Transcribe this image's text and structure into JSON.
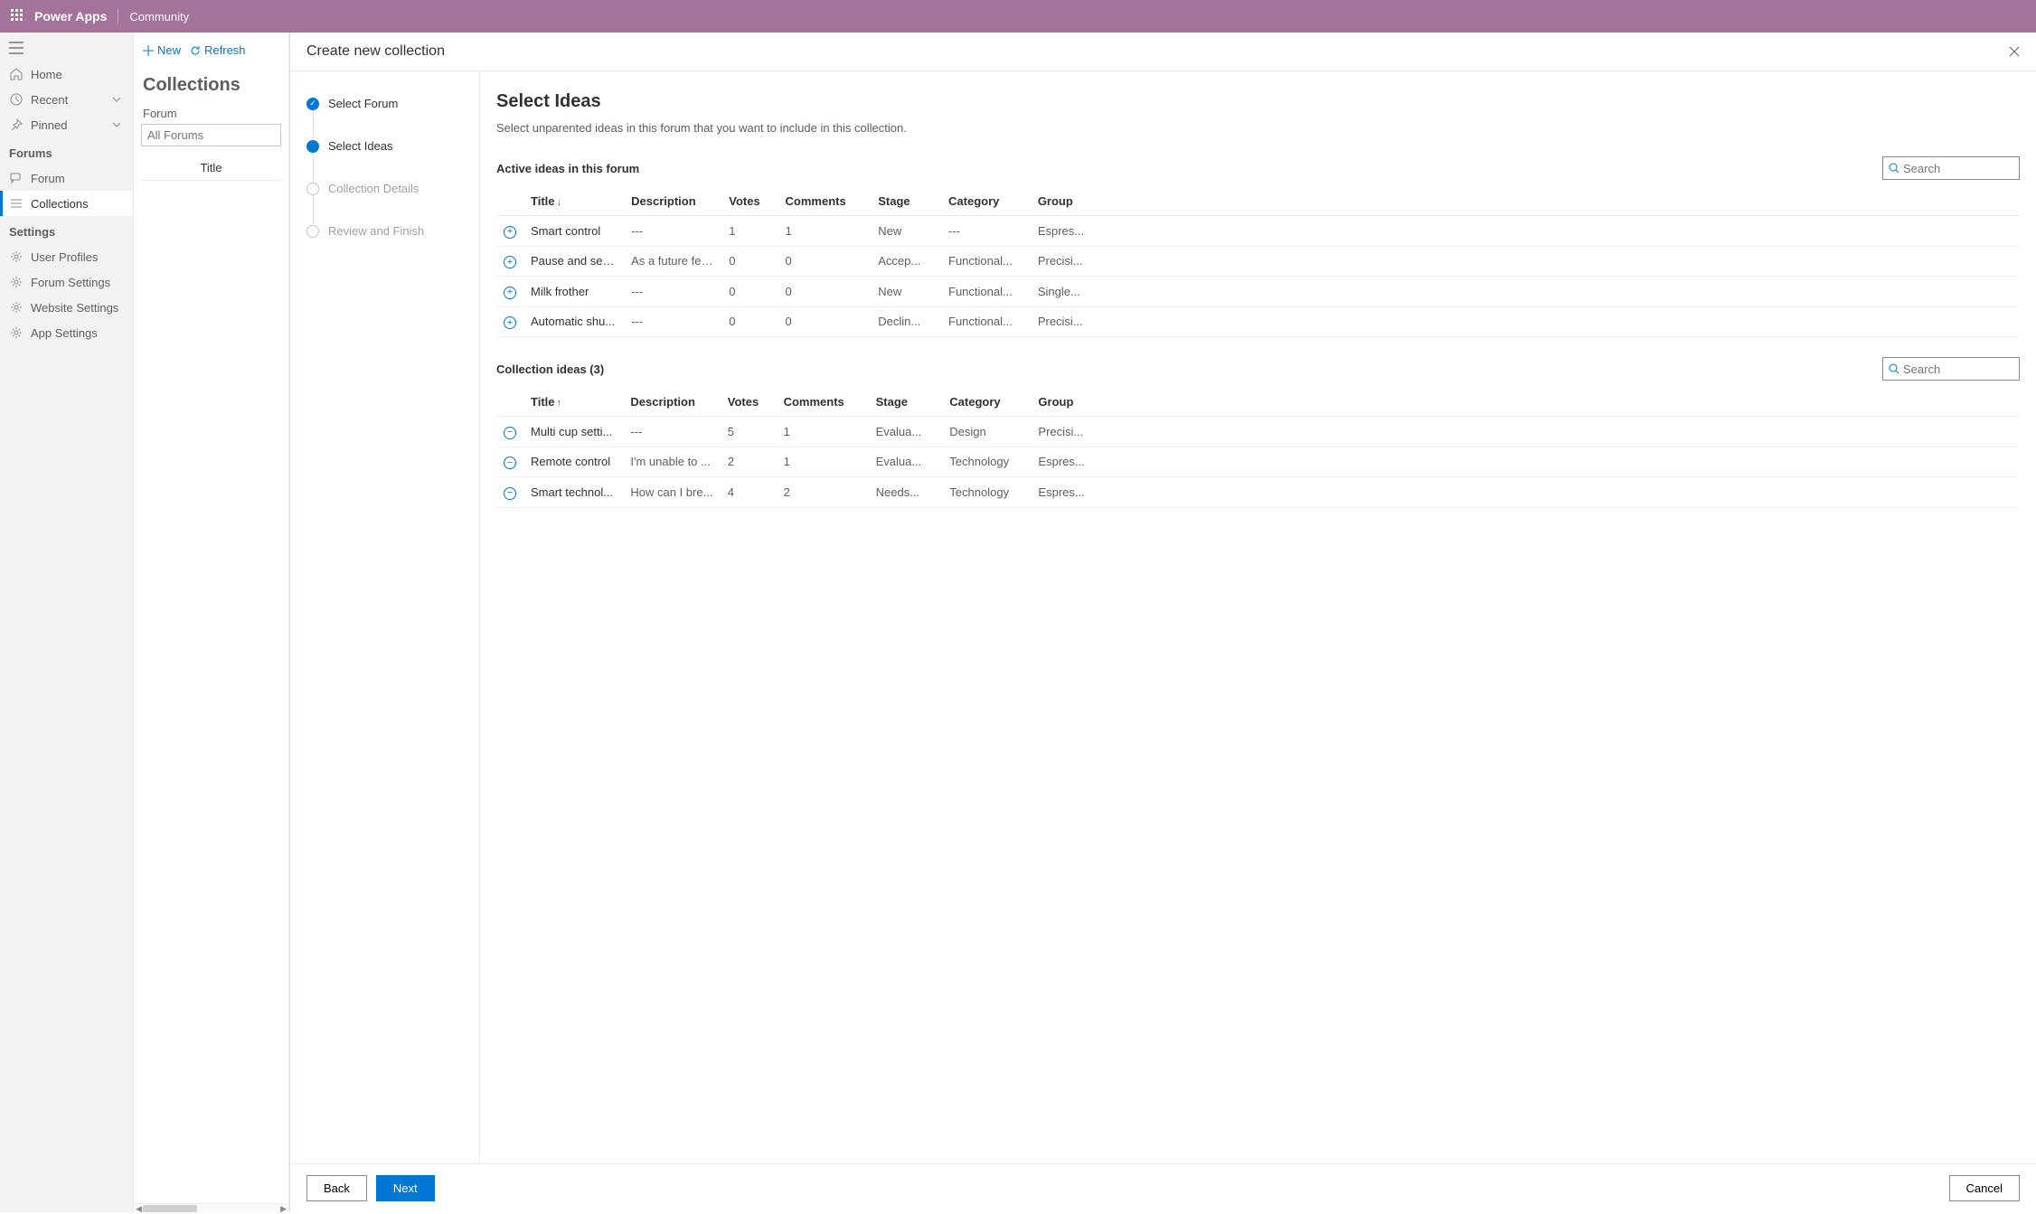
{
  "topbar": {
    "brand": "Power Apps",
    "community": "Community"
  },
  "leftnav": {
    "home": "Home",
    "recent": "Recent",
    "pinned": "Pinned",
    "forums_label": "Forums",
    "forum": "Forum",
    "collections": "Collections",
    "settings_label": "Settings",
    "user_profiles": "User Profiles",
    "forum_settings": "Forum Settings",
    "website_settings": "Website Settings",
    "app_settings": "App Settings"
  },
  "midpane": {
    "new": "New",
    "refresh": "Refresh",
    "title": "Collections",
    "forum_label": "Forum",
    "forum_placeholder": "All Forums",
    "col_title": "Title"
  },
  "modal": {
    "title": "Create new collection",
    "steps": {
      "s1": "Select Forum",
      "s2": "Select Ideas",
      "s3": "Collection Details",
      "s4": "Review and Finish"
    },
    "heading": "Select Ideas",
    "sub": "Select unparented ideas in this forum that you want to include in this collection.",
    "active_title": "Active ideas in this forum",
    "collection_title": "Collection ideas (3)",
    "search_placeholder": "Search",
    "cols": {
      "title": "Title",
      "description": "Description",
      "votes": "Votes",
      "comments": "Comments",
      "stage": "Stage",
      "category": "Category",
      "group": "Group"
    },
    "active": [
      {
        "title": "Smart control",
        "desc": "---",
        "votes": "1",
        "comments": "1",
        "stage": "New",
        "category": "---",
        "group": "Espres..."
      },
      {
        "title": "Pause and serve",
        "desc": "As a future fea...",
        "votes": "0",
        "comments": "0",
        "stage": "Accep...",
        "category": "Functional...",
        "group": "Precisi..."
      },
      {
        "title": "Milk frother",
        "desc": "---",
        "votes": "0",
        "comments": "0",
        "stage": "New",
        "category": "Functional...",
        "group": "Single..."
      },
      {
        "title": "Automatic shu...",
        "desc": "---",
        "votes": "0",
        "comments": "0",
        "stage": "Declin...",
        "category": "Functional...",
        "group": "Precisi..."
      }
    ],
    "collection": [
      {
        "title": "Multi cup setti...",
        "desc": "---",
        "votes": "5",
        "comments": "1",
        "stage": "Evalua...",
        "category": "Design",
        "group": "Precisi..."
      },
      {
        "title": "Remote control",
        "desc": "I'm unable to ...",
        "votes": "2",
        "comments": "1",
        "stage": "Evalua...",
        "category": "Technology",
        "group": "Espres..."
      },
      {
        "title": "Smart technol...",
        "desc": "How can I bre...",
        "votes": "4",
        "comments": "2",
        "stage": "Needs...",
        "category": "Technology",
        "group": "Espres..."
      }
    ],
    "footer": {
      "back": "Back",
      "next": "Next",
      "cancel": "Cancel"
    }
  }
}
